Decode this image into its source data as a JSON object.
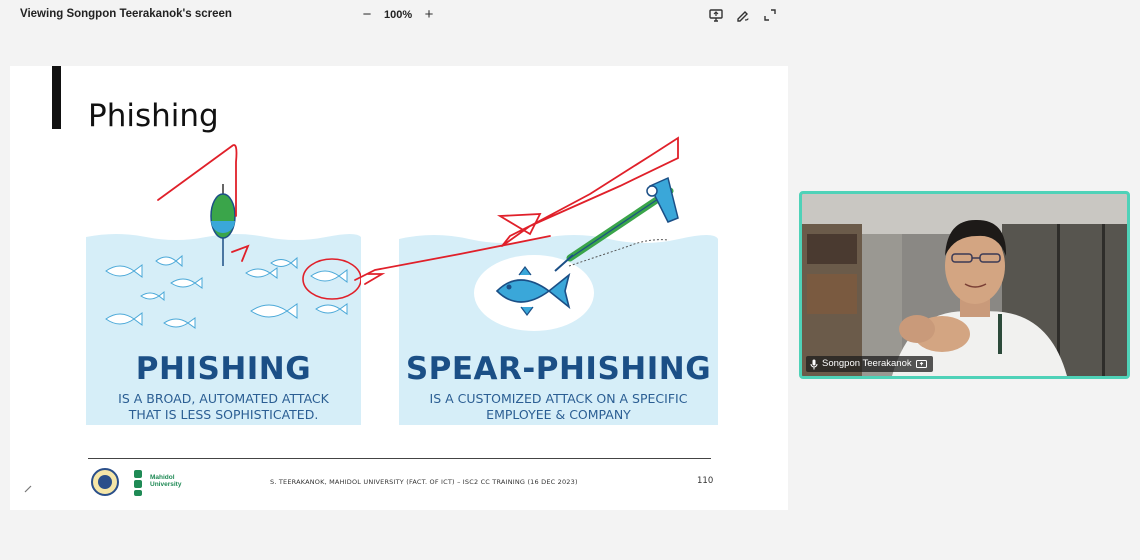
{
  "window": {
    "viewing_label": "Viewing Songpon Teerakanok's screen",
    "zoom_out_symbol": "−",
    "zoom_level": "100%",
    "zoom_in_symbol": "+",
    "tools": [
      "screen-share-icon",
      "pen-annotate-icon",
      "fullscreen-icon"
    ]
  },
  "slide": {
    "title": "Phishing",
    "left_panel": {
      "heading": "PHISHING",
      "desc_line1": "IS A BROAD, AUTOMATED ATTACK",
      "desc_line2": "THAT IS LESS SOPHISTICATED."
    },
    "right_panel": {
      "heading": "SPEAR-PHISHING",
      "desc_line1": "IS A CUSTOMIZED ATTACK ON A SPECIFIC",
      "desc_line2": "EMPLOYEE & COMPANY"
    },
    "logo_line1": "Mahidol",
    "logo_line2": "University",
    "footer": "S. TEERAKANOK, MAHIDOL UNIVERSITY (FACT. OF ICT) – ISC2 CC TRAINING (16 DEC 2023)",
    "page_number": "110",
    "colors": {
      "water": "#d6eef8",
      "heading": "#1b4f86",
      "annotation": "#e0202a",
      "fish": "#3aa7d9"
    }
  },
  "participant": {
    "name": "Songpon Teerakanok",
    "border_color": "#4fd2b8"
  }
}
